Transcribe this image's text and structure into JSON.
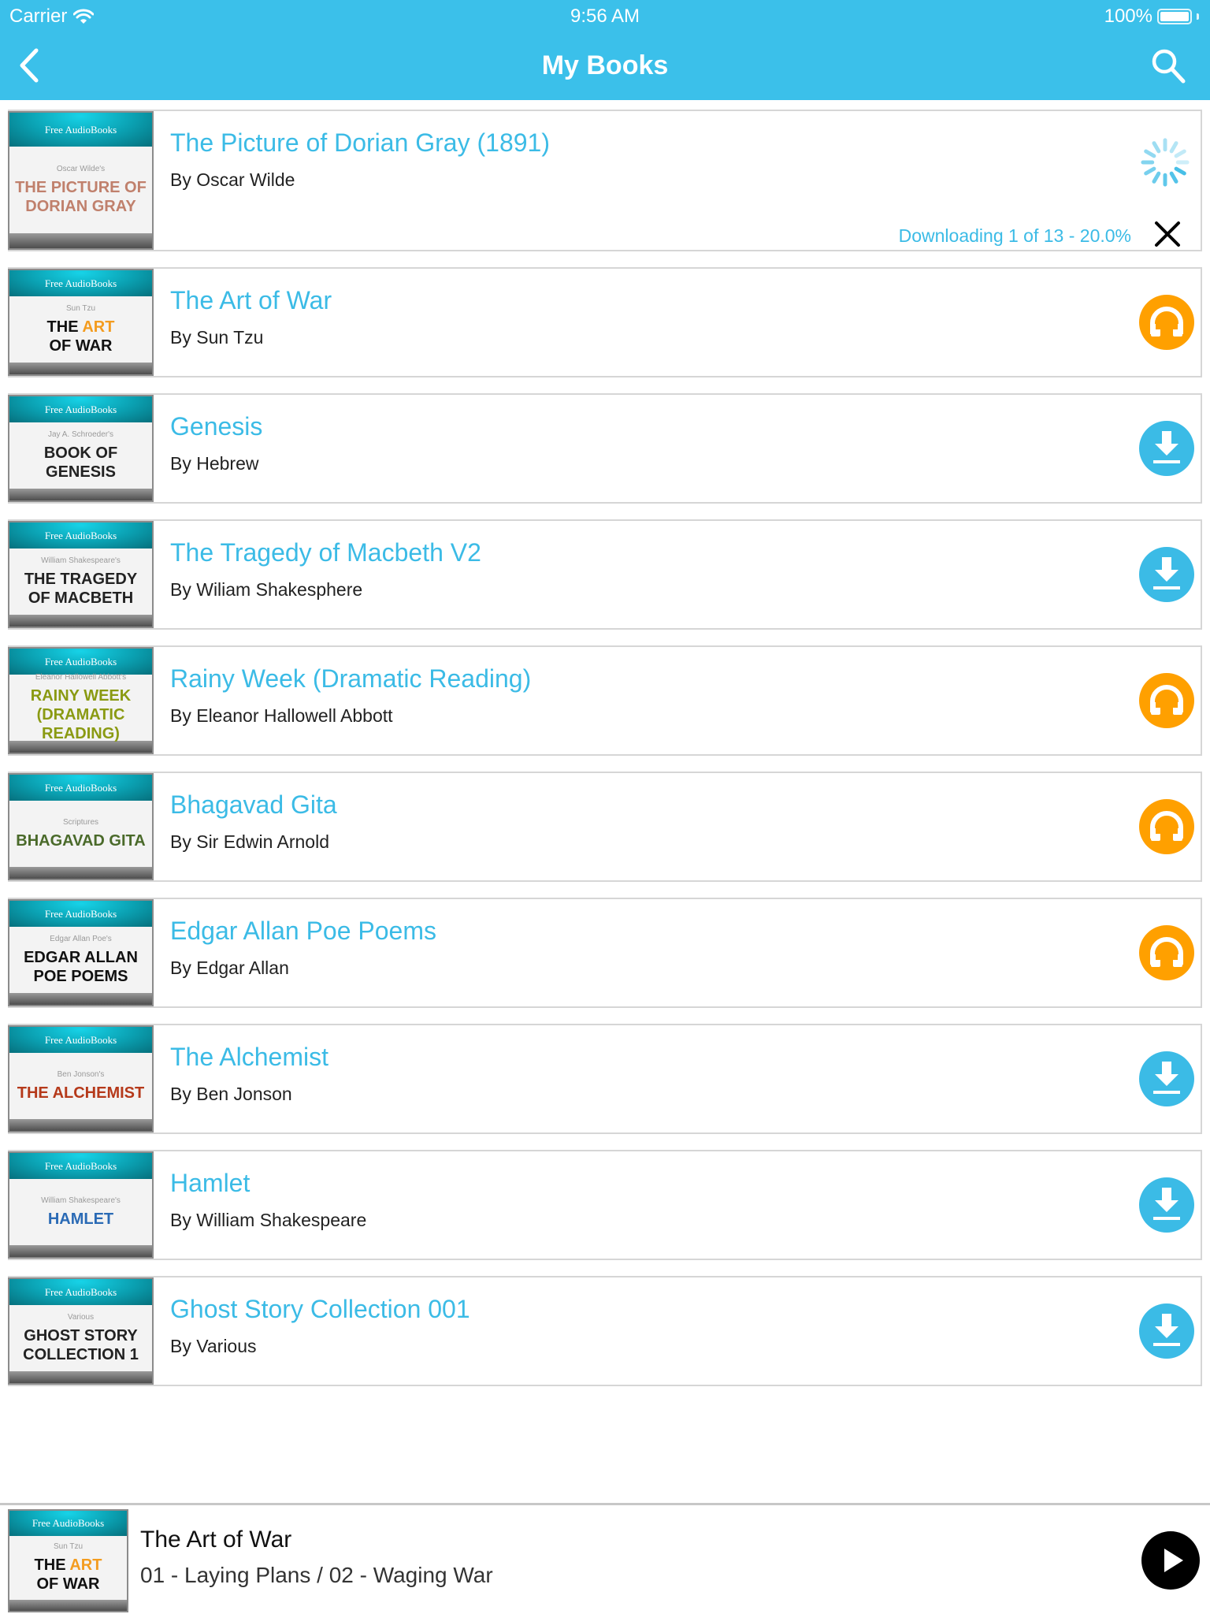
{
  "status_bar": {
    "carrier": "Carrier",
    "wifi_icon": "wifi-icon",
    "time": "9:56 AM",
    "battery_percent": "100%",
    "battery_icon": "battery-full-icon"
  },
  "nav": {
    "title": "My Books",
    "back_icon": "chevron-left-icon",
    "search_icon": "search-icon"
  },
  "colors": {
    "accent": "#3bc0ea",
    "title_text": "#3bbbe6",
    "listen_button": "#ffa000",
    "download_button": "#3bbbe6",
    "card_border": "#d6d6d6"
  },
  "books": [
    {
      "title": "The Picture of Dorian Gray (1891)",
      "author": "By Oscar Wilde",
      "cover": {
        "brand": "Free AudioBooks",
        "author": "Oscar Wilde's",
        "title": "THE PICTURE OF DORIAN GRAY",
        "title_color": "#c0806c"
      },
      "state": "downloading",
      "download_status": "Downloading 1 of 13 - 20.0%",
      "download_progress": 0.2,
      "status_icon": "loading-spinner-icon",
      "cancel_icon": "close-icon"
    },
    {
      "title": "The Art of War",
      "author": "By Sun Tzu",
      "cover": {
        "brand": "Free AudioBooks",
        "author": "Sun Tzu",
        "title_parts": [
          "THE ",
          "ART",
          " OF WAR"
        ],
        "title_color": "#111111",
        "highlight_color": "#f39c1f"
      },
      "state": "downloaded",
      "action_icon": "headphones-icon"
    },
    {
      "title": "Genesis",
      "author": "By Hebrew",
      "cover": {
        "brand": "Free AudioBooks",
        "author": "Jay A. Schroeder's",
        "title": "BOOK OF GENESIS",
        "title_color": "#222222"
      },
      "state": "not-downloaded",
      "action_icon": "download-icon"
    },
    {
      "title": "The Tragedy of Macbeth V2",
      "author": "By Wiliam Shakesphere",
      "cover": {
        "brand": "Free AudioBooks",
        "author": "William Shakespeare's",
        "title": "THE TRAGEDY OF MACBETH",
        "title_color": "#222222"
      },
      "state": "not-downloaded",
      "action_icon": "download-icon"
    },
    {
      "title": "Rainy Week (Dramatic Reading)",
      "author": "By Eleanor Hallowell Abbott",
      "cover": {
        "brand": "Free AudioBooks",
        "author": "Eleanor Hallowell Abbott's",
        "title": "RAINY WEEK (DRAMATIC READING)",
        "title_color": "#8a9a12"
      },
      "state": "downloaded",
      "action_icon": "headphones-icon"
    },
    {
      "title": "Bhagavad Gita",
      "author": "By Sir Edwin Arnold",
      "cover": {
        "brand": "Free AudioBooks",
        "author": "Scriptures",
        "title": "BHAGAVAD GITA",
        "title_color": "#4a6a2a"
      },
      "state": "downloaded",
      "action_icon": "headphones-icon"
    },
    {
      "title": "Edgar Allan Poe Poems",
      "author": "By Edgar Allan",
      "cover": {
        "brand": "Free AudioBooks",
        "author": "Edgar Allan Poe's",
        "title": "EDGAR ALLAN POE POEMS",
        "title_color": "#111111"
      },
      "state": "downloaded",
      "action_icon": "headphones-icon"
    },
    {
      "title": "The Alchemist",
      "author": "By Ben Jonson",
      "cover": {
        "brand": "Free AudioBooks",
        "author": "Ben Jonson's",
        "title": "THE ALCHEMIST",
        "title_color": "#b5391a"
      },
      "state": "not-downloaded",
      "action_icon": "download-icon"
    },
    {
      "title": "Hamlet",
      "author": "By William Shakespeare",
      "cover": {
        "brand": "Free AudioBooks",
        "author": "William Shakespeare's",
        "title": "HAMLET",
        "title_color": "#2a6ab5"
      },
      "state": "not-downloaded",
      "action_icon": "download-icon"
    },
    {
      "title": "Ghost Story Collection 001",
      "author": "By Various",
      "cover": {
        "brand": "Free AudioBooks",
        "author": "Various",
        "title": "GHOST STORY COLLECTION 1",
        "title_color": "#222222"
      },
      "state": "not-downloaded",
      "action_icon": "download-icon"
    }
  ],
  "player": {
    "title": "The Art of War",
    "track": "01 - Laying Plans / 02 - Waging War",
    "cover": {
      "brand": "Free AudioBooks",
      "author": "Sun Tzu",
      "title_parts": [
        "THE ",
        "ART",
        " OF WAR"
      ],
      "title_color": "#111111",
      "highlight_color": "#f39c1f"
    },
    "play_icon": "play-icon"
  }
}
